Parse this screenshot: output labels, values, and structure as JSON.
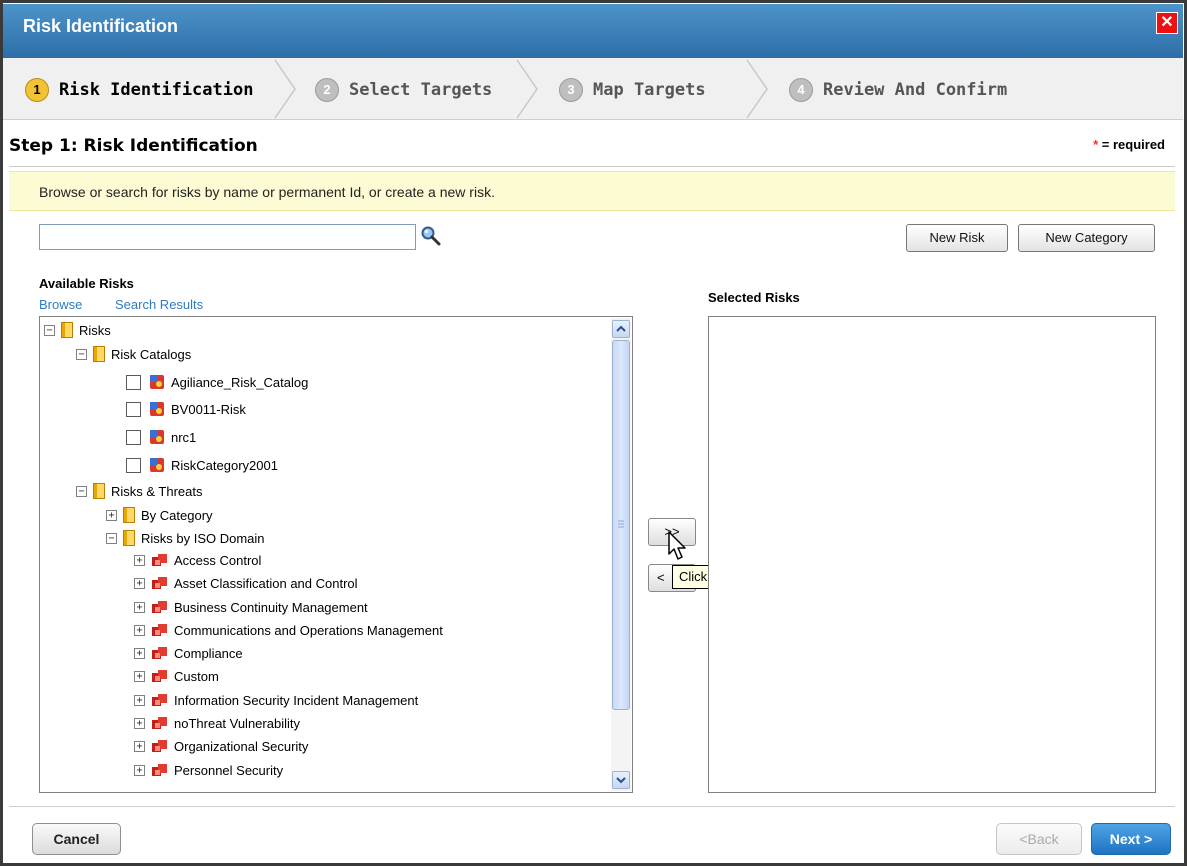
{
  "window": {
    "title": "Risk Identification",
    "close_glyph": "✕"
  },
  "steps": [
    {
      "num": "1",
      "label": "Risk Identification"
    },
    {
      "num": "2",
      "label": "Select Targets"
    },
    {
      "num": "3",
      "label": "Map Targets"
    },
    {
      "num": "4",
      "label": "Review And Confirm"
    }
  ],
  "heading": {
    "title": "Step 1: Risk Identification",
    "required_star": "*",
    "required_text": " = required"
  },
  "banner": {
    "text": "Browse or search for risks by name or permanent Id, or create a new risk."
  },
  "search": {
    "value": "",
    "placeholder": ""
  },
  "toolbar": {
    "new_risk": "New Risk",
    "new_category": "New Category"
  },
  "available": {
    "title": "Available Risks",
    "browse": "Browse",
    "search_results": "Search Results",
    "tree": {
      "root": "Risks",
      "catalogs": "Risk Catalogs",
      "catalog_items": [
        "Agiliance_Risk_Catalog",
        "BV0011-Risk",
        "nrc1",
        "RiskCategory2001"
      ],
      "threats": "Risks & Threats",
      "by_category": "By Category",
      "by_iso": "Risks by ISO Domain",
      "iso_items": [
        "Access Control",
        "Asset Classification and Control",
        "Business Continuity Management",
        "Communications and Operations Management",
        "Compliance",
        "Custom",
        "Information Security Incident Management",
        "noThreat Vulnerability",
        "Organizational Security",
        "Personnel Security"
      ]
    }
  },
  "transfer": {
    "add_label": ">>",
    "remove_label": "<",
    "tooltip": "Click to add selection"
  },
  "selected": {
    "title": "Selected Risks"
  },
  "footer": {
    "cancel": "Cancel",
    "back": "<Back",
    "next": "Next >"
  }
}
